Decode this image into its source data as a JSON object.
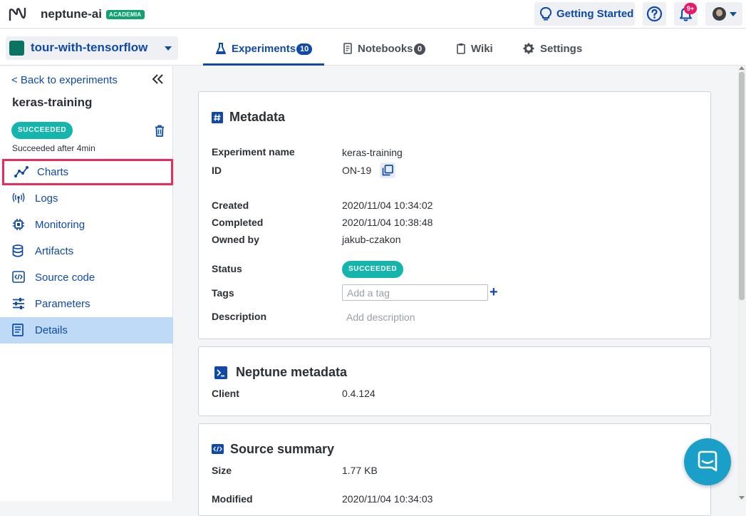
{
  "topbar": {
    "brand": "neptune-ai",
    "plan_badge": "ACADEMIA",
    "getting_started": "Getting Started",
    "notifications_count": "9+"
  },
  "project": {
    "name": "tour-with-tensorflow"
  },
  "tabs": [
    {
      "label": "Experiments",
      "count": "10"
    },
    {
      "label": "Notebooks",
      "count": "0"
    },
    {
      "label": "Wiki"
    },
    {
      "label": "Settings"
    }
  ],
  "sidebar": {
    "back_link": "< Back to experiments",
    "experiment_name": "keras-training",
    "status": "SUCCEEDED",
    "status_detail": "Succeeded after 4min",
    "items": [
      {
        "label": "Charts",
        "icon": "chart-line-icon"
      },
      {
        "label": "Logs",
        "icon": "antenna-icon"
      },
      {
        "label": "Monitoring",
        "icon": "chip-icon"
      },
      {
        "label": "Artifacts",
        "icon": "database-icon"
      },
      {
        "label": "Source code",
        "icon": "code-icon"
      },
      {
        "label": "Parameters",
        "icon": "sliders-icon"
      },
      {
        "label": "Details",
        "icon": "document-icon"
      }
    ]
  },
  "metadata": {
    "title": "Metadata",
    "experiment_name_label": "Experiment name",
    "experiment_name": "keras-training",
    "id_label": "ID",
    "id": "ON-19",
    "created_label": "Created",
    "created": "2020/11/04 10:34:02",
    "completed_label": "Completed",
    "completed": "2020/11/04 10:38:48",
    "owner_label": "Owned by",
    "owner": "jakub-czakon",
    "status_label": "Status",
    "status": "SUCCEEDED",
    "tags_label": "Tags",
    "tags_placeholder": "Add a tag",
    "description_label": "Description",
    "description_placeholder": "Add description"
  },
  "neptune_metadata": {
    "title": "Neptune metadata",
    "client_label": "Client",
    "client": "0.4.124"
  },
  "source_summary": {
    "title": "Source summary",
    "size_label": "Size",
    "size": "1.77 KB",
    "modified_label": "Modified",
    "modified": "2020/11/04 10:34:03"
  },
  "colors": {
    "accent": "#0f4aa8",
    "success": "#13b5ad",
    "highlight": "#ea2b5b",
    "active_bg": "#bfdaf7"
  }
}
